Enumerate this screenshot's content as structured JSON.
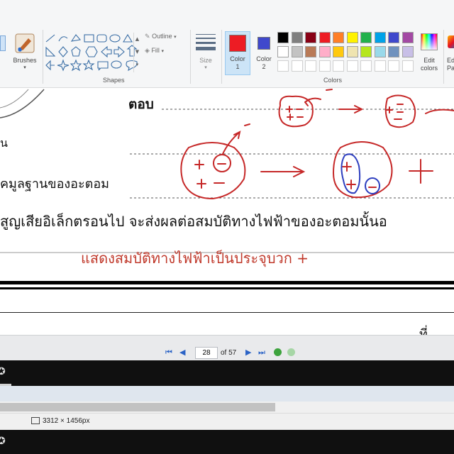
{
  "ribbon": {
    "brushes_label": "Brushes",
    "shapes_group_label": "Shapes",
    "outline_label": "Outline",
    "fill_label": "Fill",
    "size_label": "Size",
    "color1_label": "Color",
    "color1_num": "1",
    "color2_label": "Color",
    "color2_num": "2",
    "colors_group_label": "Colors",
    "edit_colors_label": "Edit",
    "edit_colors_label2": "colors",
    "edit_paint3d_label": "Ed",
    "edit_paint3d_label2": "Pa",
    "color1_value": "#ed1c24",
    "color2_value": "#3f48cc",
    "palette_row1": [
      "#000000",
      "#7f7f7f",
      "#880015",
      "#ed1c24",
      "#ff7f27",
      "#fff200",
      "#22b14c",
      "#00a2e8",
      "#3f48cc",
      "#a349a4"
    ],
    "palette_row2": [
      "#ffffff",
      "#c3c3c3",
      "#b97a57",
      "#ffaec9",
      "#ffc90e",
      "#efe4b0",
      "#b5e61d",
      "#99d9ea",
      "#7092be",
      "#c8bfe7"
    ]
  },
  "doc": {
    "answer_label": "ตอบ",
    "side_text_1": "น",
    "side_text_2": "คมูลฐานของอะตอม",
    "main_sentence": "สูญเสียอิเล็กตรอนไป จะส่งผลต่อสมบัติทางไฟฟ้าของอะตอมนั้นอ",
    "red_sentence": "แสดงสมบัติทางไฟฟ้าเป็นประจุบวก +",
    "tail_text": "ที่"
  },
  "pdf_nav": {
    "page_value": "28",
    "of_label": "of 57"
  },
  "status": {
    "dimensions": "3312 × 1456px"
  }
}
